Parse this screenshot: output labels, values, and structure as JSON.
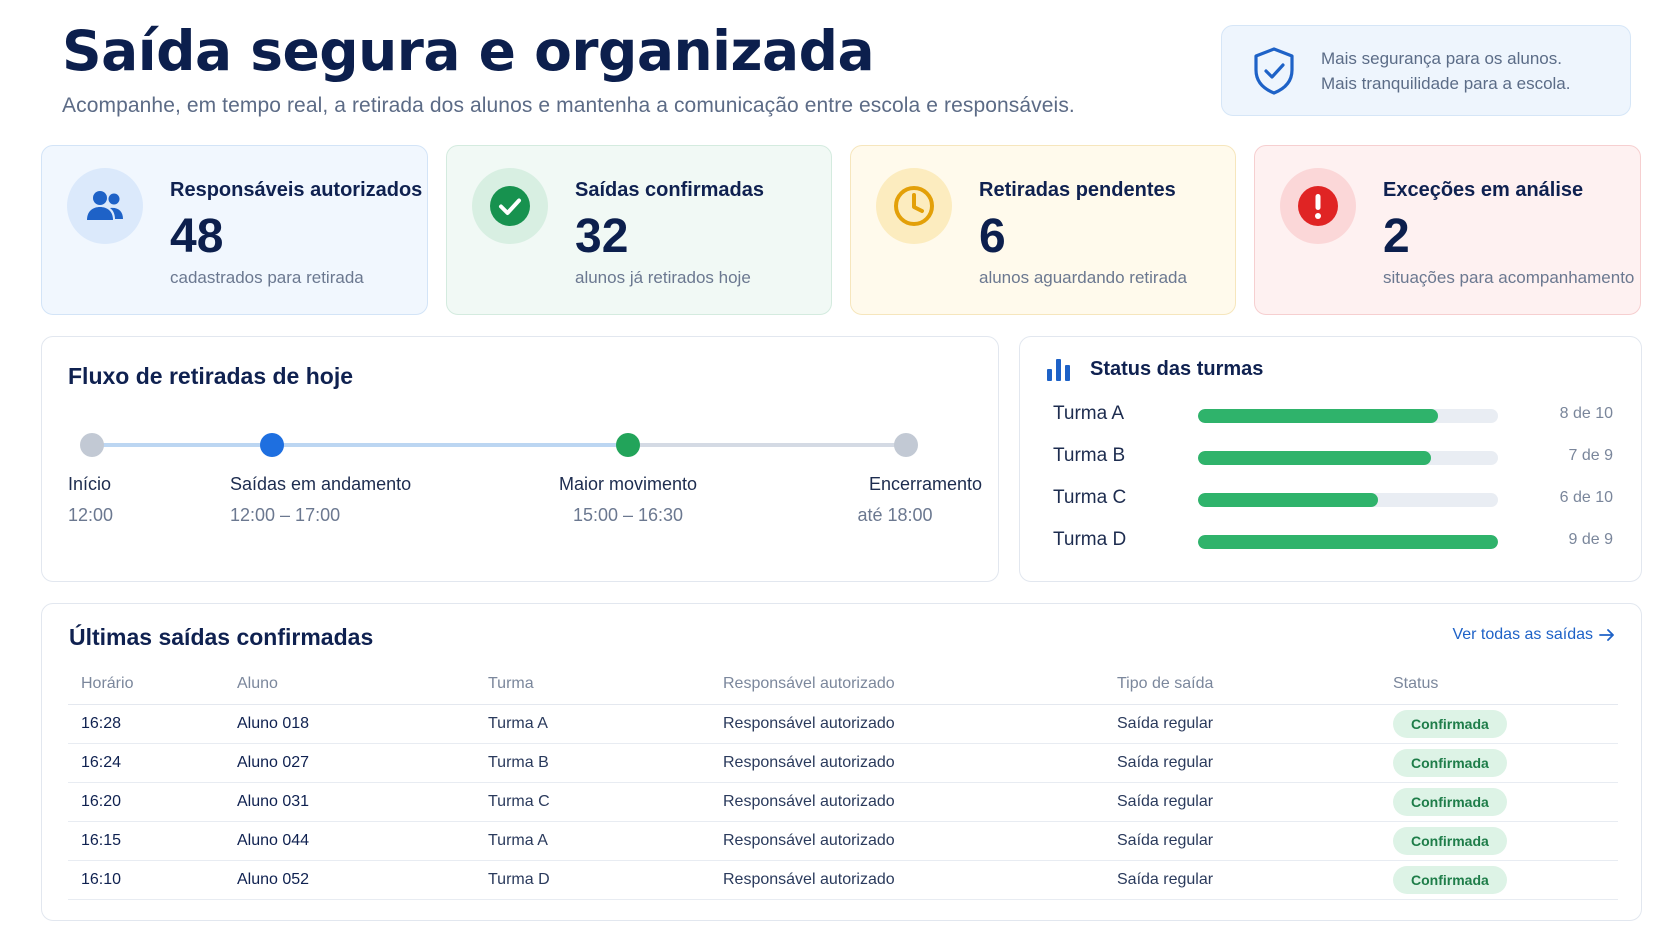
{
  "header": {
    "title": "Saída segura e organizada",
    "subtitle": "Acompanhe, em tempo real, a retirada dos alunos e mantenha a comunicação entre escola e responsáveis.",
    "notice": {
      "icon": "shield-check-icon",
      "line1": "Mais segurança para os alunos.",
      "line2": "Mais tranquilidade para a escola."
    }
  },
  "kpis": [
    {
      "title": "Responsáveis autorizados",
      "value": "48",
      "caption": "cadastrados para retirada",
      "icon": "users-icon",
      "color": "#1e62c7"
    },
    {
      "title": "Saídas confirmadas",
      "value": "32",
      "caption": "alunos já retirados hoje",
      "icon": "check-circle-icon",
      "color": "#17924f"
    },
    {
      "title": "Retiradas pendentes",
      "value": "6",
      "caption": "alunos aguardando retirada",
      "icon": "clock-icon",
      "color": "#e3a008"
    },
    {
      "title": "Exceções em análise",
      "value": "2",
      "caption": "situações para acompanhamento",
      "icon": "alert-icon",
      "color": "#e02424"
    }
  ],
  "flow": {
    "title": "Fluxo de retiradas de hoje",
    "milestones": [
      {
        "label": "Início",
        "value": "12:00",
        "state": "done"
      },
      {
        "label": "Saídas em andamento",
        "value": "12:00 – 17:00",
        "state": "current"
      },
      {
        "label": "Maior movimento",
        "value": "15:00 – 16:30",
        "state": "peak"
      },
      {
        "label": "Encerramento",
        "value": "até 18:00",
        "state": "upcoming"
      }
    ]
  },
  "status": {
    "title": "Status das turmas",
    "icon": "bar-chart-icon",
    "rows": [
      {
        "label": "Turma A",
        "done": 8,
        "total": 10,
        "text": "8 de 10"
      },
      {
        "label": "Turma B",
        "done": 7,
        "total": 9,
        "text": "7 de 9"
      },
      {
        "label": "Turma C",
        "done": 6,
        "total": 10,
        "text": "6 de 10"
      },
      {
        "label": "Turma D",
        "done": 9,
        "total": 9,
        "text": "9 de 9"
      }
    ]
  },
  "latest": {
    "title": "Últimas saídas confirmadas",
    "view_all": "Ver todas as saídas",
    "columns": [
      "Horário",
      "Aluno",
      "Turma",
      "Responsável autorizado",
      "Tipo de saída",
      "Status"
    ],
    "rows": [
      [
        "16:28",
        "Aluno 018",
        "Turma A",
        "Responsável autorizado",
        "Saída regular",
        "Confirmada"
      ],
      [
        "16:24",
        "Aluno 027",
        "Turma B",
        "Responsável autorizado",
        "Saída regular",
        "Confirmada"
      ],
      [
        "16:20",
        "Aluno 031",
        "Turma C",
        "Responsável autorizado",
        "Saída regular",
        "Confirmada"
      ],
      [
        "16:15",
        "Aluno 044",
        "Turma A",
        "Responsável autorizado",
        "Saída regular",
        "Confirmada"
      ],
      [
        "16:10",
        "Aluno 052",
        "Turma D",
        "Responsável autorizado",
        "Saída regular",
        "Confirmada"
      ]
    ]
  }
}
